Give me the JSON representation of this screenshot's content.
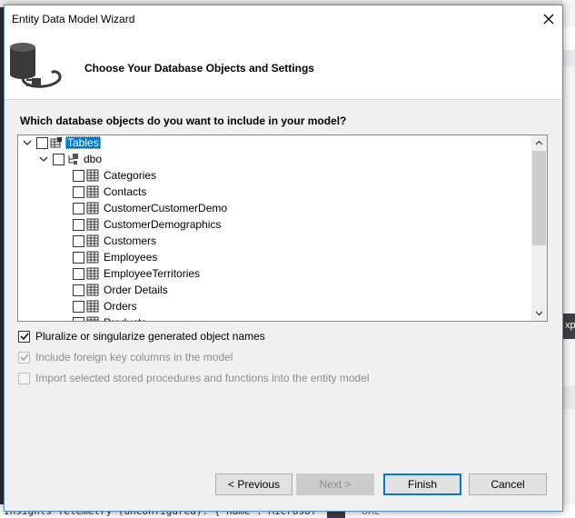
{
  "window": {
    "title": "Entity Data Model Wizard"
  },
  "header": {
    "title": "Choose Your Database Objects and Settings",
    "icon": "database-plug-icon"
  },
  "question": "Which database objects do you want to include in your model?",
  "tree": {
    "root_label": "Tables",
    "schema_label": "dbo",
    "tables": [
      "Categories",
      "Contacts",
      "CustomerCustomerDemo",
      "CustomerDemographics",
      "Customers",
      "Employees",
      "EmployeeTerritories",
      "Order Details",
      "Orders",
      "Products"
    ]
  },
  "options": {
    "pluralize": "Pluralize or singularize generated object names",
    "foreign_keys": "Include foreign key columns in the model",
    "import_procs": "Import selected stored procedures and functions into the entity model"
  },
  "buttons": {
    "previous": "< Previous",
    "next": "Next >",
    "finish": "Finish",
    "cancel": "Cancel"
  },
  "background": {
    "code_line": "Insights Telemetry (unconfigured): { name : Microsof",
    "side_text": "xp",
    "url_text": "URL"
  },
  "colors": {
    "selection": "#0078d7",
    "primary_border": "#0078d7"
  }
}
